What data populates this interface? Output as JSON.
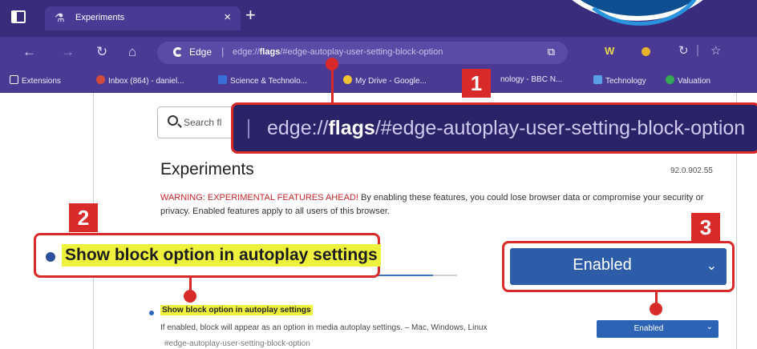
{
  "tab": {
    "icon": "flask-icon",
    "title": "Experiments",
    "close": "×"
  },
  "window": {
    "new_tab": "+"
  },
  "nav": {
    "back": "←",
    "forward": "→",
    "refresh": "↻",
    "home": "⌂"
  },
  "address": {
    "browser_label": "Edge",
    "separator": "|",
    "url_prefix": "edge://",
    "url_bold": "flags",
    "url_suffix": "/#edge-autoplay-user-setting-block-option"
  },
  "toolbar_icons": {
    "w_ext": "W",
    "more": "↻",
    "divider": "|",
    "favorites": "☆"
  },
  "favorites": [
    {
      "label": "Extensions",
      "icon": "page-icon",
      "color": "#ffffff"
    },
    {
      "label": "Inbox (864) - daniel...",
      "icon": "mail-icon",
      "color": "#d34b3a"
    },
    {
      "label": "Science & Technolo...",
      "icon": "news-icon",
      "color": "#3a6fd8"
    },
    {
      "label": "My Drive - Google...",
      "icon": "drive-icon",
      "color": "#f1c232"
    },
    {
      "label": "nology - BBC N...",
      "icon": "bbc-icon",
      "color": "#ffffff"
    },
    {
      "label": "Technology",
      "icon": "tech-icon",
      "color": "#5aa0e6"
    },
    {
      "label": "Valuation",
      "icon": "valuation-icon",
      "color": "#34a853"
    }
  ],
  "search": {
    "placeholder": "Search fl"
  },
  "experiments": {
    "title": "Experiments",
    "version": "92.0.902.55",
    "warning_label": "WARNING: EXPERIMENTAL FEATURES AHEAD!",
    "warning_text": " By enabling these features, you could lose browser data or compromise your security or privacy. Enabled features apply to all users of this browser."
  },
  "feature": {
    "name": "Show block option in autoplay settings",
    "description": "If enabled, block will appear as an option in media autoplay settings. – Mac, Windows, Linux",
    "anchor": "#edge-autoplay-user-setting-block-option",
    "state": "Enabled"
  },
  "callouts": {
    "url": {
      "number": "1",
      "prefix": "edge://",
      "bold": "flags",
      "suffix": "/#edge-autoplay-user-setting-block-option"
    },
    "feature": {
      "number": "2",
      "text": "Show block option in autoplay settings"
    },
    "select": {
      "number": "3",
      "value": "Enabled"
    }
  },
  "colors": {
    "chrome_dark": "#3a2c7c",
    "chrome": "#4b3a94",
    "callout_red": "#d92a2a",
    "highlight": "#eef23c",
    "select_blue": "#2d5da9",
    "warning_red": "#c4262b"
  }
}
